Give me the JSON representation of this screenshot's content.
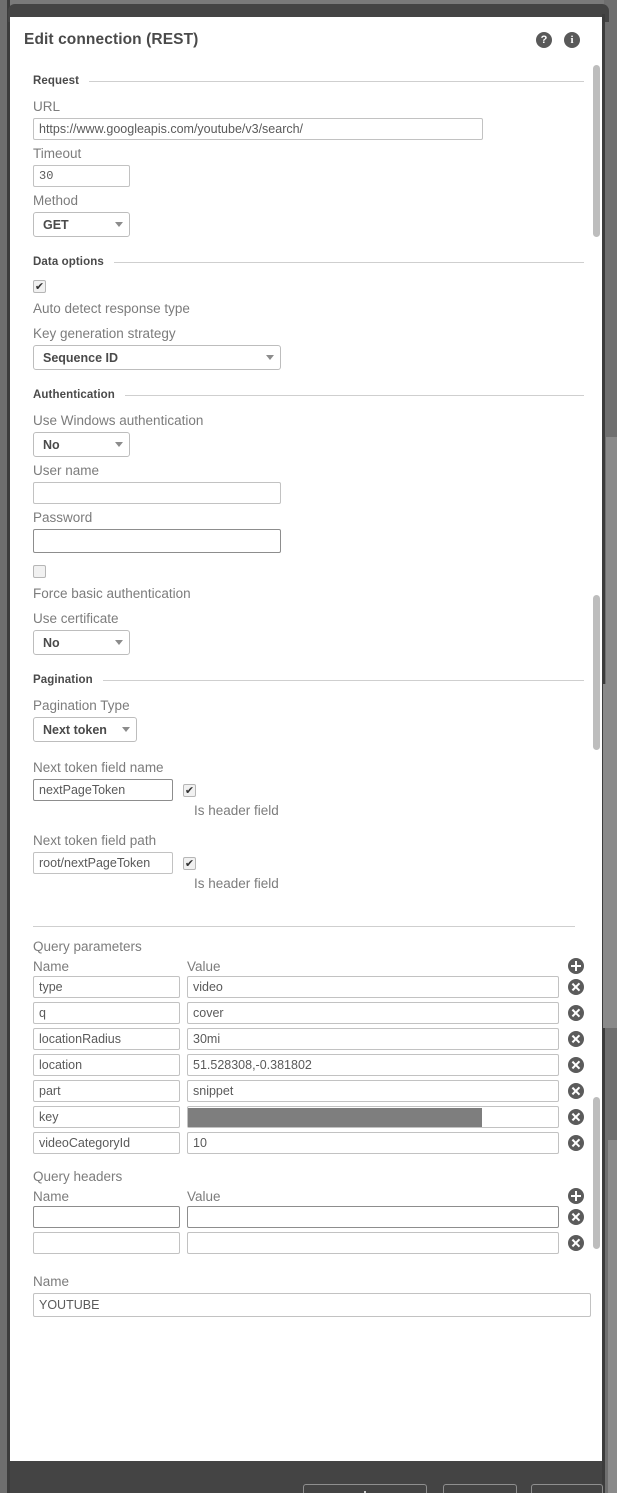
{
  "dialog": {
    "title": "Edit connection (REST)",
    "help_icon": "help-circle-icon",
    "help_glyph": "?",
    "info_icon": "info-circle-icon",
    "info_glyph": "i"
  },
  "sections": {
    "request": "Request",
    "data_options": "Data options",
    "authentication": "Authentication",
    "pagination": "Pagination"
  },
  "request": {
    "url_label": "URL",
    "url_value": "https://www.googleapis.com/youtube/v3/search/",
    "timeout_label": "Timeout",
    "timeout_value": "30",
    "method_label": "Method",
    "method_value": "GET"
  },
  "data_options": {
    "auto_detect_label": "Auto detect response type",
    "auto_detect_checked": true,
    "auto_detect_mark": "✔",
    "key_strategy_label": "Key generation strategy",
    "key_strategy_value": "Sequence ID"
  },
  "authentication": {
    "windows_auth_label": "Use Windows authentication",
    "windows_auth_value": "No",
    "username_label": "User name",
    "username_value": "",
    "password_label": "Password",
    "password_value": "",
    "force_basic_label": "Force basic authentication",
    "force_basic_checked": false,
    "use_certificate_label": "Use certificate",
    "use_certificate_value": "No"
  },
  "pagination": {
    "type_label": "Pagination Type",
    "type_value": "Next token",
    "token_name_label": "Next token field name",
    "token_name_value": "nextPageToken",
    "token_name_is_header_label": "Is header field",
    "token_name_is_header_checked": true,
    "token_path_label": "Next token field path",
    "token_path_value": "root/nextPageToken",
    "token_path_is_header_label": "Is header field",
    "token_path_is_header_checked": true,
    "check_mark": "✔"
  },
  "query_parameters": {
    "title": "Query parameters",
    "col_name": "Name",
    "col_value": "Value",
    "add_icon": "plus-circle-icon",
    "remove_icon": "remove-circle-icon",
    "rows": [
      {
        "name": "type",
        "value": "video"
      },
      {
        "name": "q",
        "value": "cover"
      },
      {
        "name": "locationRadius",
        "value": "30mi"
      },
      {
        "name": "location",
        "value": "51.528308,-0.381802"
      },
      {
        "name": "part",
        "value": "snippet"
      },
      {
        "name": "key",
        "value": "",
        "redacted": true
      },
      {
        "name": "videoCategoryId",
        "value": "10"
      }
    ]
  },
  "query_headers": {
    "title": "Query headers",
    "col_name": "Name",
    "col_value": "Value",
    "rows": [
      {
        "name": "",
        "value": ""
      },
      {
        "name": "",
        "value": ""
      }
    ]
  },
  "connection": {
    "name_label": "Name",
    "name_value": "YOUTUBE"
  },
  "colors": {
    "chrome": "#444444",
    "dialog_bg": "#ffffff",
    "label": "#7c7c7c",
    "icon": "#5b5b5b",
    "redaction": "#7e7e7e",
    "border": "#c2c2c2"
  }
}
